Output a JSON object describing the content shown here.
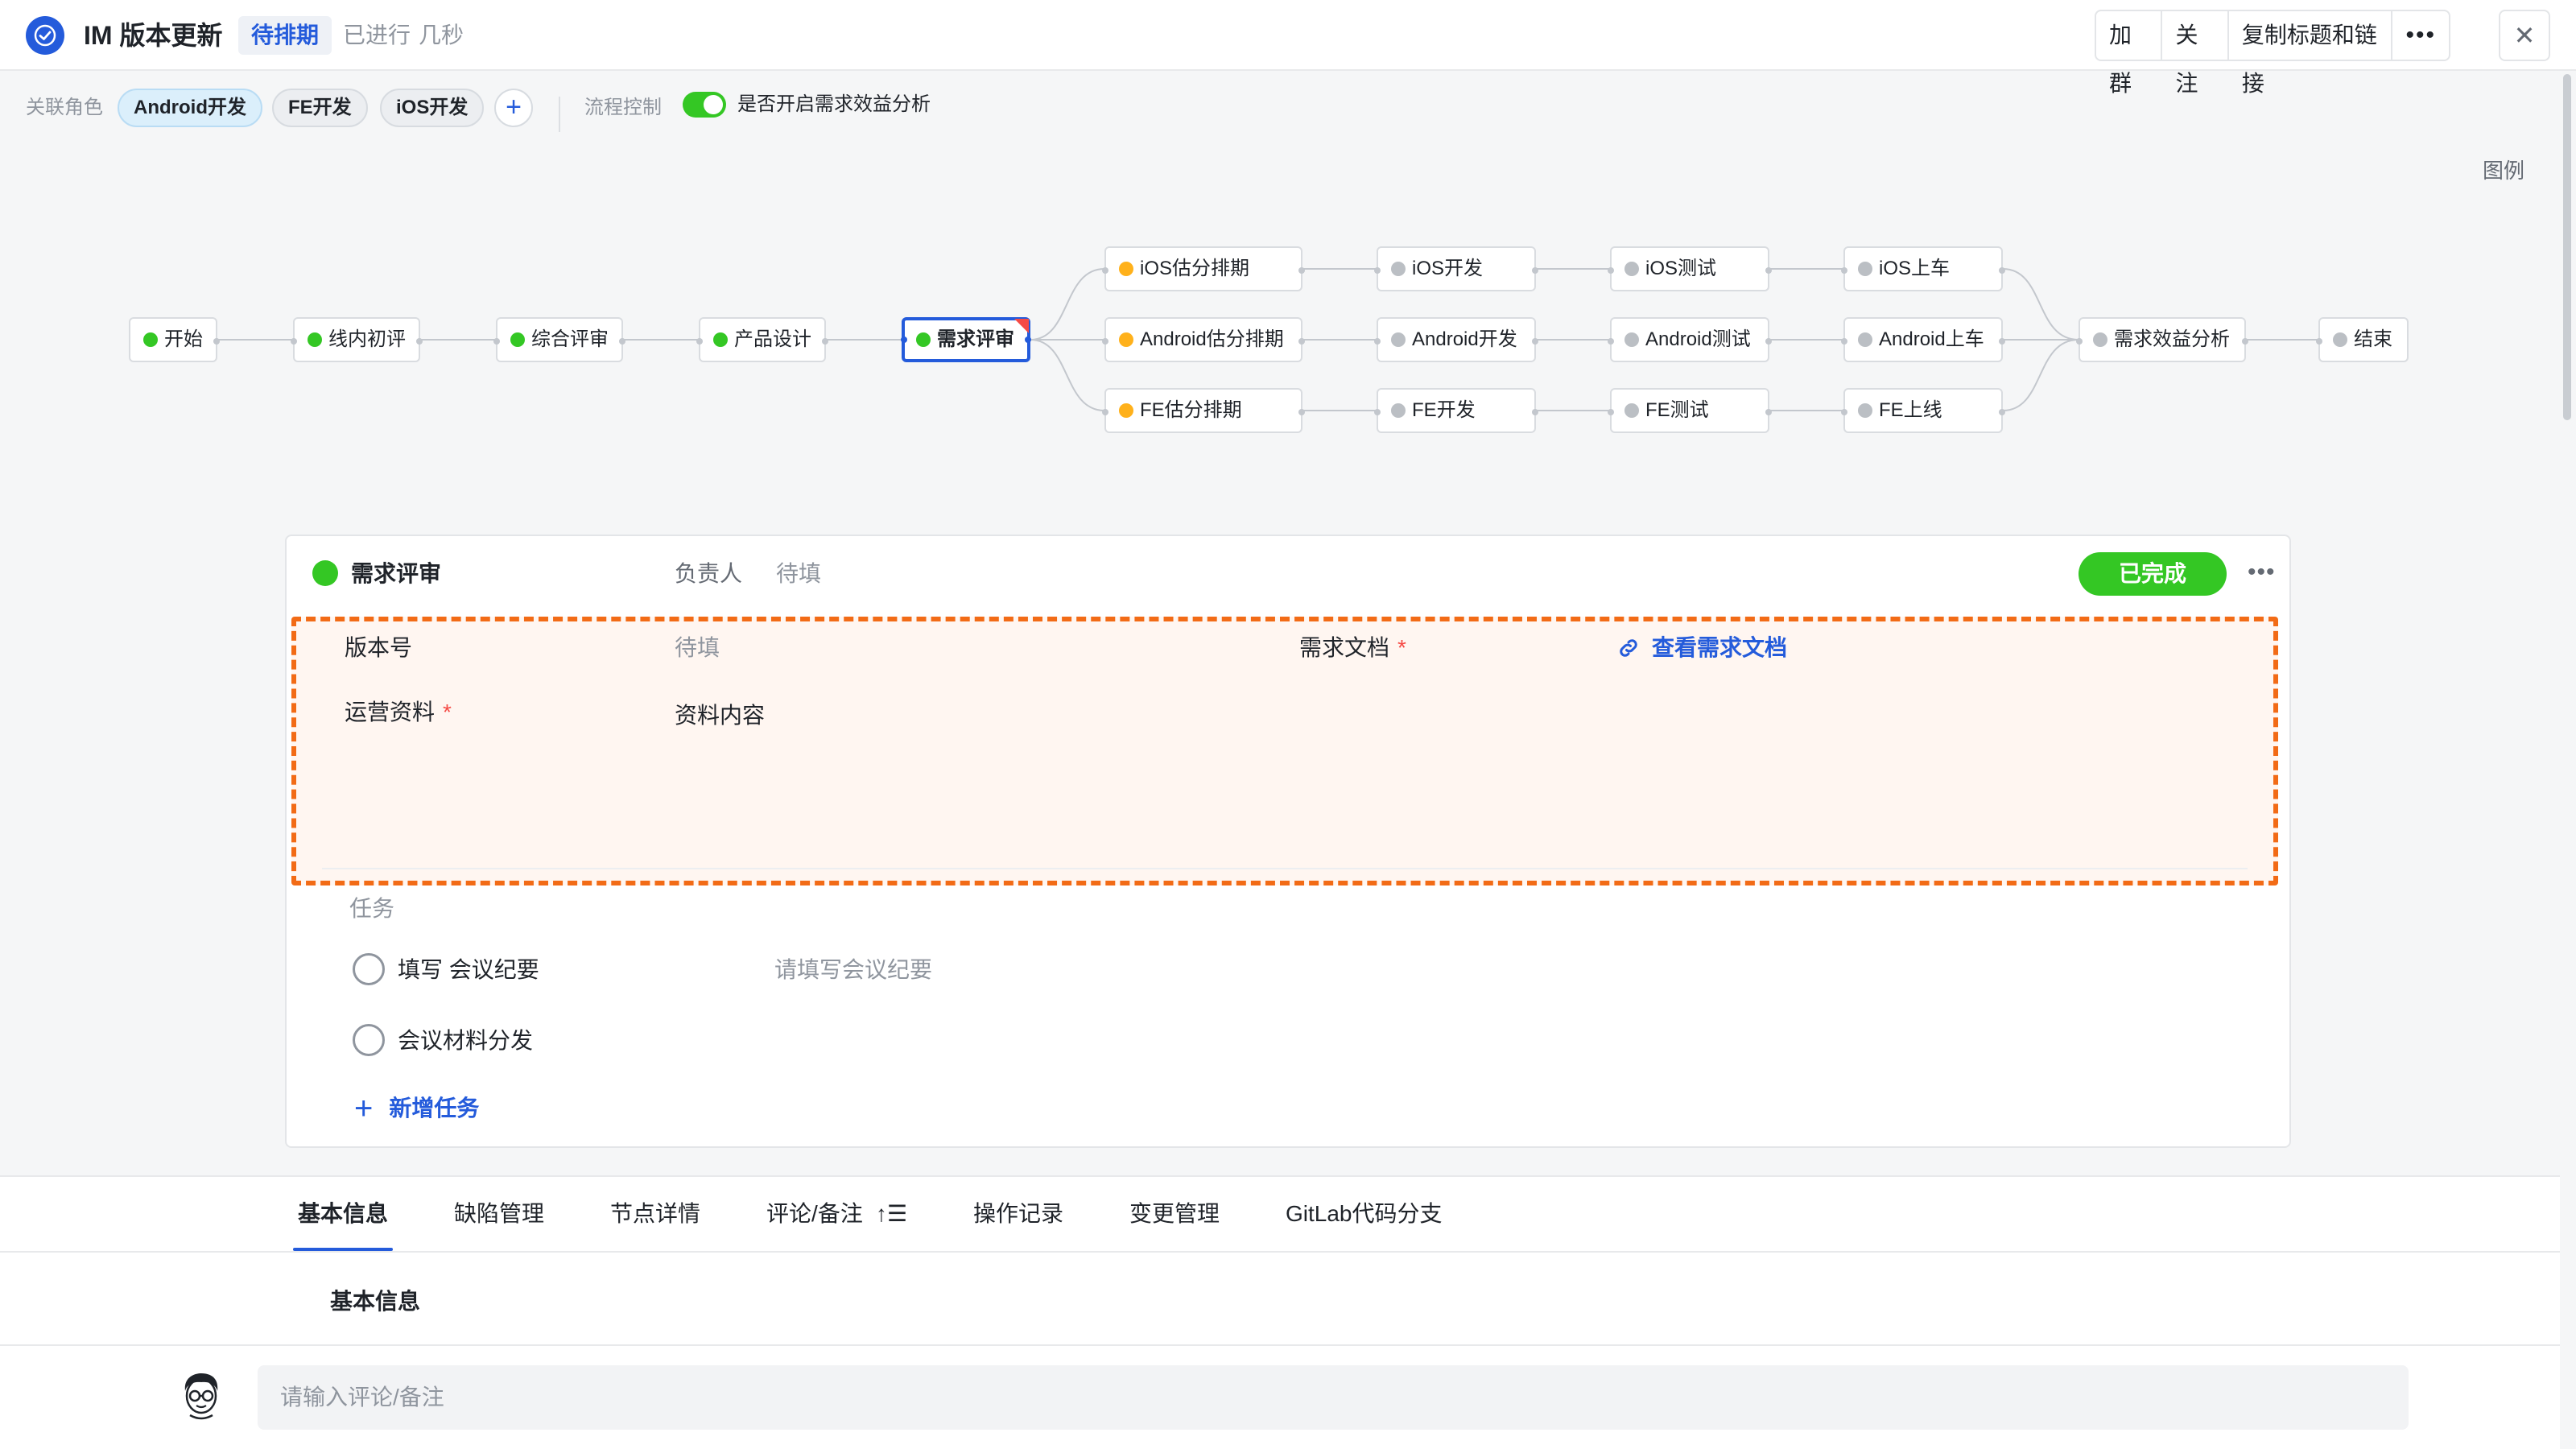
{
  "header": {
    "title": "IM 版本更新",
    "status": "待排期",
    "elapsed_prefix": "已进行",
    "elapsed_value": "几秒",
    "actions": {
      "join_group": "加群",
      "follow": "关注",
      "copy_title_link": "复制标题和链接",
      "more": "•••"
    },
    "close": "✕"
  },
  "roles": {
    "label": "关联角色",
    "items": [
      "Android开发",
      "FE开发",
      "iOS开发"
    ],
    "add": "+"
  },
  "flow_control": {
    "label": "流程控制",
    "toggle_label": "是否开启需求效益分析",
    "toggle_on": true
  },
  "legend": "图例",
  "flow": {
    "nodes": {
      "start": "开始",
      "initial_review": "线内初评",
      "comprehensive_review": "综合评审",
      "product_design": "产品设计",
      "requirement_review": "需求评审",
      "ios_estimate": "iOS估分排期",
      "android_estimate": "Android估分排期",
      "fe_estimate": "FE估分排期",
      "ios_dev": "iOS开发",
      "android_dev": "Android开发",
      "fe_dev": "FE开发",
      "ios_test": "iOS测试",
      "android_test": "Android测试",
      "fe_test": "FE测试",
      "ios_release": "iOS上车",
      "android_release": "Android上车",
      "fe_release": "FE上线",
      "benefit_analysis": "需求效益分析",
      "end": "结束"
    },
    "status_colors": {
      "done": "#34c724",
      "in_progress": "#ffb11b",
      "pending": "#bbbfc4"
    }
  },
  "detail": {
    "title": "需求评审",
    "owner_label": "负责人",
    "owner_value": "待填",
    "complete_button": "已完成",
    "more": "•••",
    "fields": {
      "version_label": "版本号",
      "version_value": "待填",
      "doc_label": "需求文档",
      "doc_required": "*",
      "doc_link": "查看需求文档",
      "ops_label": "运营资料",
      "ops_required": "*",
      "ops_value": "资料内容"
    },
    "tasks_title": "任务",
    "tasks": [
      {
        "name": "填写 会议纪要",
        "hint": "请填写会议纪要"
      },
      {
        "name": "会议材料分发",
        "hint": ""
      }
    ],
    "add_task": "新增任务"
  },
  "tabs": {
    "items": [
      "基本信息",
      "缺陷管理",
      "节点详情",
      "评论/备注",
      "操作记录",
      "变更管理",
      "GitLab代码分支"
    ],
    "sort_icon": "↑☰"
  },
  "section_title": "基本信息",
  "comment": {
    "placeholder": "请输入评论/备注"
  },
  "colors": {
    "accent": "#245bdb",
    "success": "#34c724",
    "warning": "#ffb11b",
    "danger": "#f54a45",
    "highlight_border": "#f26b16"
  }
}
